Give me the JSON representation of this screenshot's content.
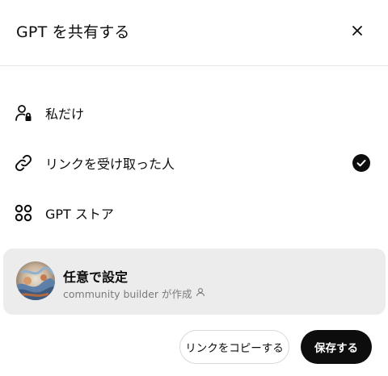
{
  "dialog": {
    "title": "GPT を共有する",
    "close_icon": "close-icon"
  },
  "options": [
    {
      "label": "私だけ",
      "icon": "user-lock-icon",
      "selected": false
    },
    {
      "label": "リンクを受け取った人",
      "icon": "link-icon",
      "selected": true
    },
    {
      "label": "GPT ストア",
      "icon": "grid-dots-icon",
      "selected": false
    }
  ],
  "category_card": {
    "title": "任意で設定",
    "subtitle": "community builder が作成",
    "subtitle_icon": "person-icon"
  },
  "footer": {
    "copy_link_label": "リンクをコピーする",
    "save_label": "保存する"
  },
  "colors": {
    "primary": "#0d0d0d",
    "card_bg": "#ececec",
    "muted_text": "#7a7a7a"
  }
}
